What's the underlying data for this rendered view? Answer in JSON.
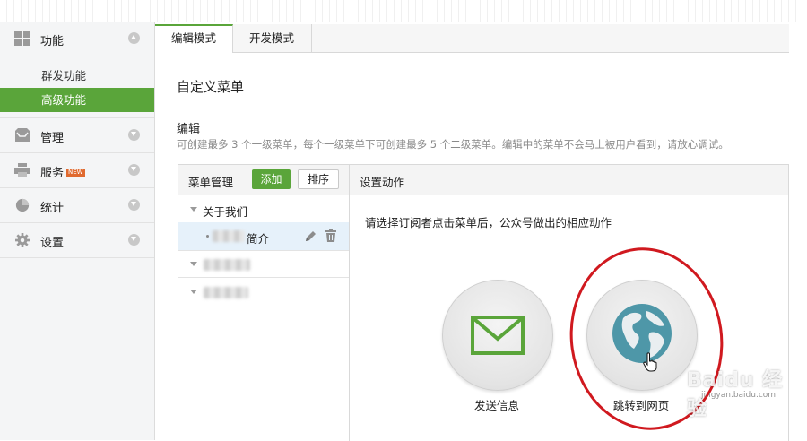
{
  "sidebar": {
    "groups": [
      {
        "label": "功能",
        "icon": "grid-icon"
      },
      {
        "label": "管理",
        "icon": "inbox-icon"
      },
      {
        "label": "服务",
        "icon": "printer-icon",
        "badge": "NEW"
      },
      {
        "label": "统计",
        "icon": "pie-chart-icon"
      },
      {
        "label": "设置",
        "icon": "gear-icon"
      }
    ],
    "sub_items": [
      "群发功能",
      "高级功能"
    ]
  },
  "tabs": [
    "编辑模式",
    "开发模式"
  ],
  "page_title": "自定义菜单",
  "section": {
    "title": "编辑",
    "description": "可创建最多 3 个一级菜单，每个一级菜单下可创建最多 5 个二级菜单。编辑中的菜单不会马上被用户看到，请放心调试。"
  },
  "menu_manager": {
    "title": "菜单管理",
    "add_label": "添加",
    "sort_label": "排序",
    "items": [
      {
        "label": "关于我们",
        "level": 1
      },
      {
        "label": "简介",
        "level": 2
      }
    ]
  },
  "action_panel": {
    "title": "设置动作",
    "instruction": "请选择订阅者点击菜单后，公众号做出的相应动作",
    "actions": [
      {
        "label": "发送信息",
        "icon": "envelope-icon"
      },
      {
        "label": "跳转到网页",
        "icon": "globe-icon"
      }
    ]
  },
  "watermark": {
    "brand": "Baidu 经验",
    "url": "jingyan.baidu.com"
  },
  "colors": {
    "accent": "#5aa53a",
    "highlight_ring": "#d0191f",
    "globe": "#4e97a8",
    "envelope": "#5aa53a"
  }
}
